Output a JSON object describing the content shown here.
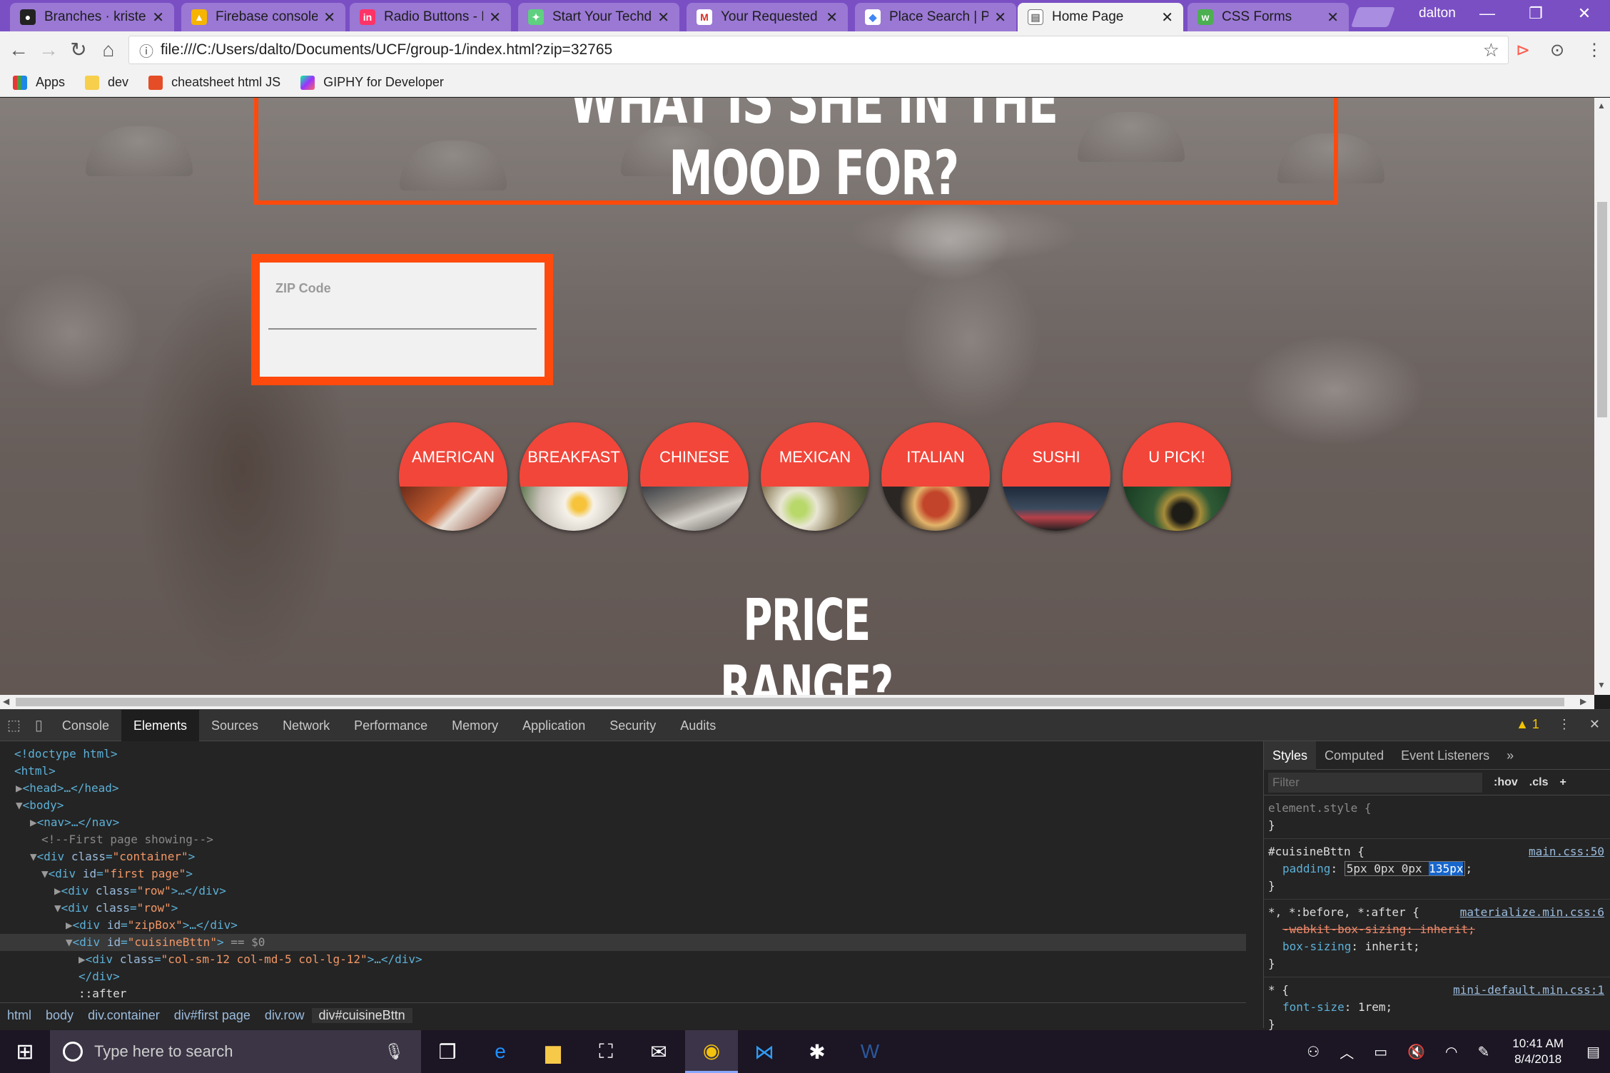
{
  "browser": {
    "tabs": [
      {
        "title": "Branches · kristenn",
        "icon": "github-icon",
        "color": "#222222"
      },
      {
        "title": "Firebase console",
        "icon": "firebase-icon",
        "color": "#f5b400"
      },
      {
        "title": "Radio Buttons - M",
        "icon": "invision-icon",
        "color": "#ff3366"
      },
      {
        "title": "Start Your Techdeg",
        "icon": "treehouse-icon",
        "color": "#5fcf80"
      },
      {
        "title": "Your Requested O",
        "icon": "gmail-icon",
        "color": "#d93025"
      },
      {
        "title": "Place Search | Pla",
        "icon": "google-maps-icon",
        "color": "#4285f4"
      },
      {
        "title": "Home Page",
        "icon": "page-icon",
        "color": "#777777"
      },
      {
        "title": "CSS Forms",
        "icon": "w3schools-icon",
        "color": "#4caf50"
      }
    ],
    "active_tab": 6,
    "user_name": "dalton",
    "url": "file:///C:/Users/dalto/Documents/UCF/group-1/index.html?zip=32765",
    "bookmarks": [
      {
        "label": "Apps",
        "icon": "apps-grid-icon"
      },
      {
        "label": "dev",
        "icon": "folder-icon"
      },
      {
        "label": "cheatsheet html JS",
        "icon": "html5-icon"
      },
      {
        "label": "GIPHY for Developer",
        "icon": "giphy-icon"
      }
    ]
  },
  "page": {
    "hero_title": "WHAT IS SHE IN THE MOOD FOR?",
    "zip": {
      "label": "ZIP Code",
      "value": ""
    },
    "cuisines": [
      "AMERICAN",
      "BREAKFAST",
      "CHINESE",
      "MEXICAN",
      "ITALIAN",
      "SUSHI",
      "U PICK!"
    ],
    "price_title": "PRICE RANGE?",
    "accent_color": "#ff4a0d",
    "button_color": "#f2463a"
  },
  "devtools": {
    "tabs": [
      "Console",
      "Elements",
      "Sources",
      "Network",
      "Performance",
      "Memory",
      "Application",
      "Security",
      "Audits"
    ],
    "active_tab": "Elements",
    "warning_count": "1",
    "dom_lines": {
      "l1": "<!doctype html>",
      "l2": "<html>",
      "l3_tag": "<head>",
      "l3_end": "…</head>",
      "l4": "<body>",
      "l5_tag": "<nav>",
      "l5_end": "…</nav>",
      "l6": "<!--First page showing-->",
      "l7_open": "<div",
      "l7_attr": "class",
      "l7_val": "\"container\"",
      "l8_open": "<div",
      "l8_attr": "id",
      "l8_val": "\"first page\"",
      "l9_open": "<div",
      "l9_attr": "class",
      "l9_val": "\"row\"",
      "l9_end": ">…</div>",
      "l10_open": "<div",
      "l10_attr": "class",
      "l10_val": "\"row\"",
      "l11_open": "<div",
      "l11_attr": "id",
      "l11_val": "\"zipBox\"",
      "l11_end": ">…</div>",
      "l12_open": "<div",
      "l12_attr": "id",
      "l12_val": "\"cuisineBttn\"",
      "l12_eq": "== $0",
      "l13_open": "<div",
      "l13_attr": "class",
      "l13_val": "\"col-sm-12 col-md-5 col-lg-12\"",
      "l13_end": ">…</div>",
      "l14": "</div>",
      "l15": "::after"
    },
    "breadcrumbs": [
      "html",
      "body",
      "div.container",
      "div#first page",
      "div.row",
      "div#cuisineBttn"
    ],
    "styles": {
      "tabs": [
        "Styles",
        "Computed",
        "Event Listeners"
      ],
      "filter_placeholder": "Filter",
      "hov": ":hov",
      "cls": ".cls",
      "element_style": "element.style {",
      "rule1_selector": "#cuisineBttn {",
      "rule1_src": "main.css:50",
      "rule1_prop": "padding",
      "rule1_val": "5px 0px 0px ",
      "rule1_val_hl": "135px",
      "rule2_selector": "*, *:before, *:after {",
      "rule2_src": "materialize.min.css:6",
      "rule2_struck": "-webkit-box-sizing: inherit;",
      "rule2_prop": "box-sizing",
      "rule2_val": "inherit;",
      "rule3_selector": "* {",
      "rule3_src": "mini-default.min.css:1",
      "rule3_prop": "font-size",
      "rule3_val": "1rem;",
      "brace_close": "}"
    }
  },
  "taskbar": {
    "search_placeholder": "Type here to search",
    "apps": [
      "task-view-icon",
      "edge-icon",
      "file-explorer-icon",
      "store-icon",
      "mail-icon",
      "chrome-icon",
      "vscode-icon",
      "slack-icon",
      "word-icon"
    ],
    "time": "10:41 AM",
    "date": "8/4/2018"
  }
}
